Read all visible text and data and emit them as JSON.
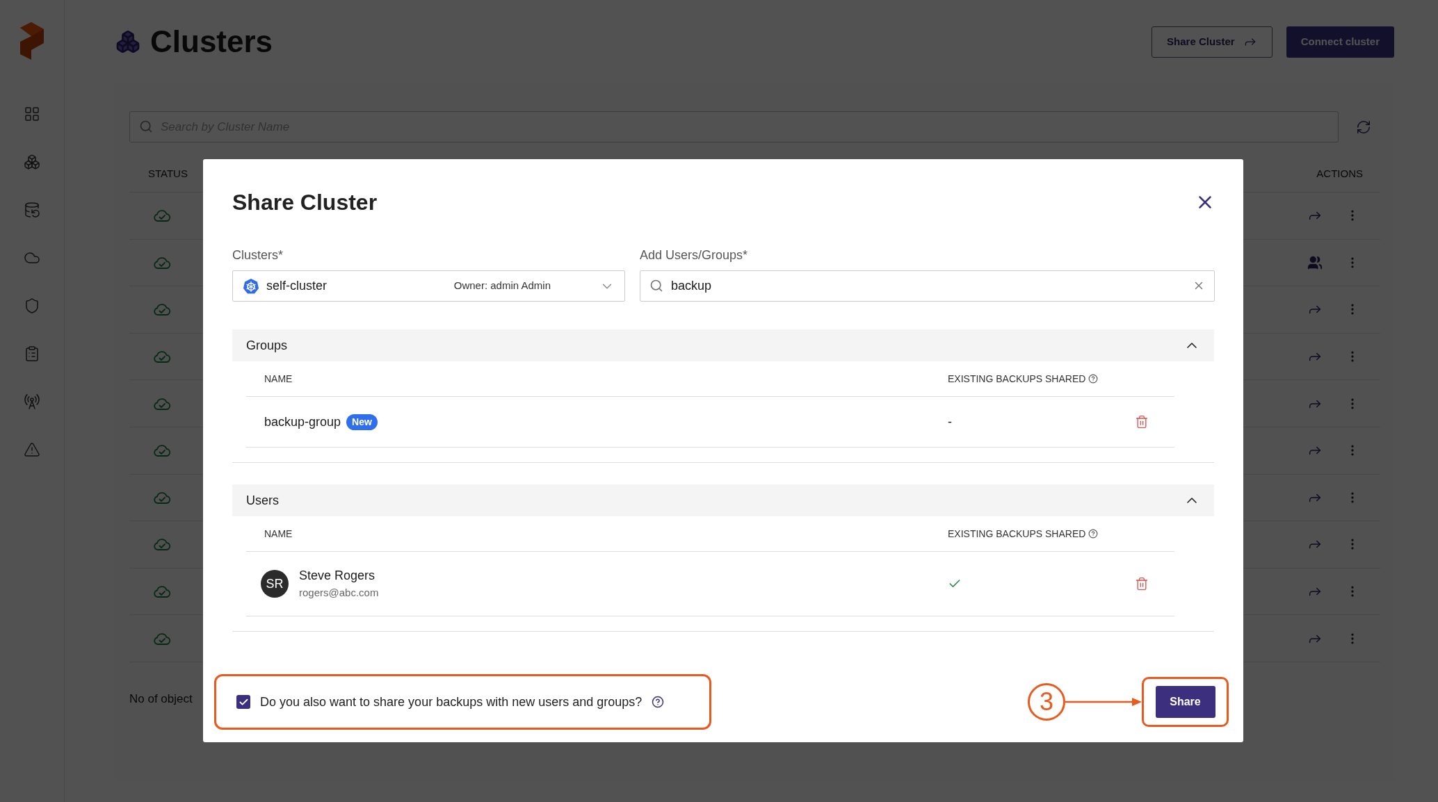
{
  "page": {
    "title": "Clusters",
    "buttons": [
      {
        "label": "Share Cluster",
        "kind": "outline"
      },
      {
        "label": "Connect cluster",
        "kind": "primary"
      }
    ],
    "search": {
      "placeholder": "Search by Cluster Name"
    },
    "table": {
      "columns": [
        "STATUS",
        "ACTIONS"
      ],
      "rows": [
        {
          "kind": "share"
        },
        {
          "kind": "group"
        },
        {
          "kind": "share"
        },
        {
          "kind": "share"
        },
        {
          "kind": "share"
        },
        {
          "kind": "share"
        },
        {
          "kind": "share"
        },
        {
          "kind": "share"
        },
        {
          "kind": "share"
        },
        {
          "kind": "share"
        }
      ]
    },
    "footer": "No of object"
  },
  "dialog": {
    "title": "Share Cluster",
    "clusters": {
      "label": "Clusters*",
      "value": "self-cluster",
      "owner": "Owner: admin Admin"
    },
    "users_field": {
      "label": "Add Users/Groups*",
      "value": "backup"
    },
    "sections": [
      {
        "title": "Groups",
        "expanded": true,
        "columns": [
          "NAME",
          "EXISTING BACKUPS SHARED"
        ],
        "rows": [
          {
            "kind": "group",
            "name": "backup-group",
            "badge": "New",
            "existing": "-"
          }
        ]
      },
      {
        "title": "Users",
        "expanded": true,
        "columns": [
          "NAME",
          "EXISTING BACKUPS SHARED"
        ],
        "rows": [
          {
            "kind": "user",
            "initials": "SR",
            "name": "Steve Rogers",
            "email": "rogers@abc.com",
            "existing_shared": true
          }
        ]
      }
    ],
    "share_backups": {
      "label": "Do you also want to share your backups with new users and groups?",
      "checked": true
    },
    "share_button": "Share"
  },
  "annotation": {
    "step": "3"
  }
}
